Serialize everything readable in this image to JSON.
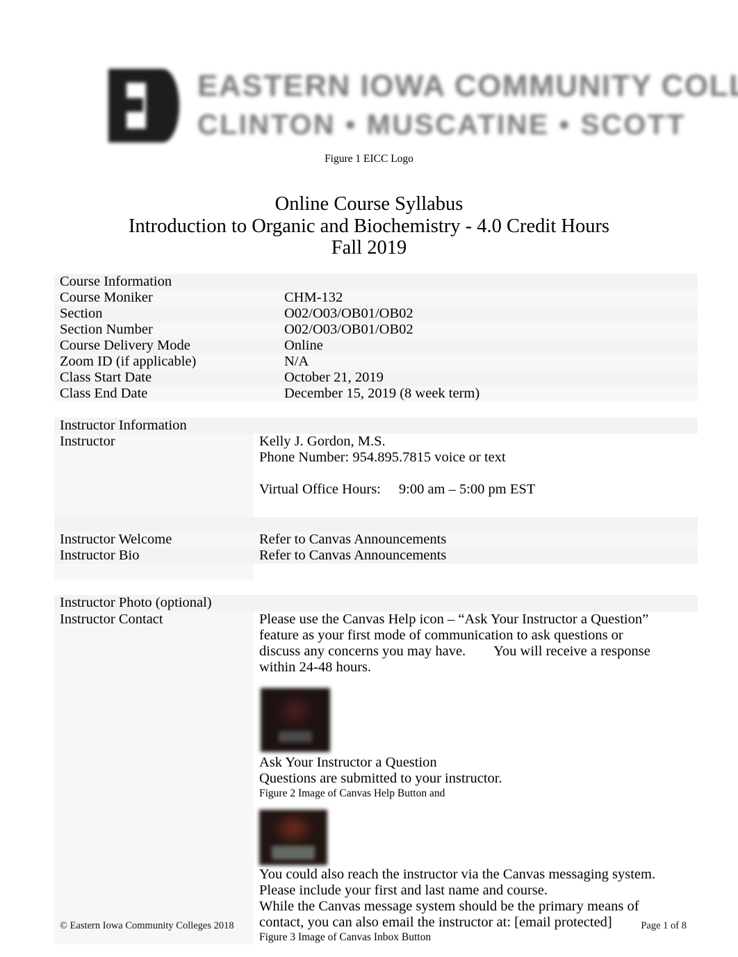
{
  "logo": {
    "mark_alt": "EI",
    "line1": "EASTERN IOWA COMMUNITY COLLEGES",
    "line2": "CLINTON • MUSCATINE • SCOTT",
    "caption": "Figure 1 EICC Logo"
  },
  "titles": {
    "line1": "Online Course Syllabus",
    "line2": "Introduction to Organic and Biochemistry - 4.0 Credit Hours",
    "line3": "Fall 2019"
  },
  "course_table": {
    "heading": "Course Information",
    "rows": [
      {
        "label": "Course Moniker",
        "value": "CHM-132"
      },
      {
        "label": "Section",
        "value": "O02/O03/OB01/OB02"
      },
      {
        "label": "Section Number",
        "value": "O02/O03/OB01/OB02"
      },
      {
        "label": "Course Delivery Mode",
        "value": "Online"
      },
      {
        "label": "Zoom ID (if applicable)",
        "value": "N/A"
      },
      {
        "label": "Class Start Date",
        "value": "October 21, 2019"
      },
      {
        "label": "Class End Date",
        "value": "December 15, 2019 (8 week term)"
      }
    ]
  },
  "instructor_table": {
    "heading": "Instructor Information",
    "instructor_label": "Instructor",
    "instructor_name": "Kelly J. Gordon, M.S.",
    "instructor_phone": "Phone Number: 954.895.7815 voice or text",
    "office_hours_label": "Virtual Office Hours:",
    "office_hours_value": "9:00 am – 5:00 pm EST",
    "welcome_label": "Instructor Welcome",
    "welcome_value": "Refer to Canvas Announcements",
    "bio_label": "Instructor Bio",
    "bio_value": "Refer to Canvas Announcements",
    "photo_label": "Instructor Photo (optional)",
    "contact_label": "Instructor Contact",
    "contact_p1_a": "Please use the Canvas Help icon – “Ask Your Instructor a Question” feature as your first mode of communication to ask questions or discuss any concerns you may have.",
    "contact_p1_b": "You will receive a response within 24-48 hours.",
    "ask_title": "Ask Your Instructor a Question",
    "ask_subtitle": "Questions are submitted to your instructor.",
    "figure2_caption": "Figure 2 Image of Canvas Help Button and",
    "canvas_msg_l1": "You could also reach the instructor via the Canvas messaging system.",
    "canvas_msg_l2": "Please include your first and last name and course.",
    "canvas_msg_l3": "While the Canvas message system should be the primary means of",
    "canvas_msg_l4": "contact, you can also email the instructor at: [email protected]",
    "figure3_caption": "Figure 3 Image of Canvas Inbox Button"
  },
  "footer": {
    "copyright": "© Eastern Iowa Community Colleges 2018",
    "page": "Page 1 of 8"
  }
}
